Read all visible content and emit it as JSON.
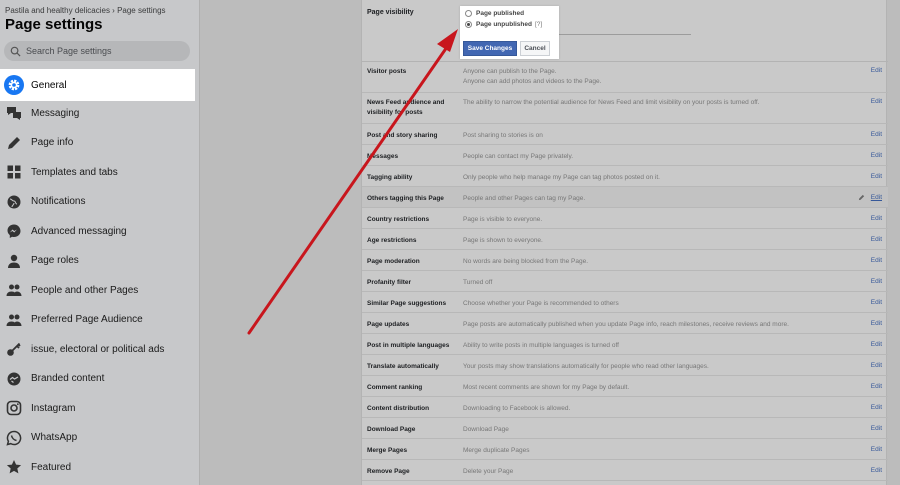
{
  "sidebar": {
    "breadcrumb": "Pastila and healthy delicacies › Page settings",
    "title": "Page settings",
    "search_placeholder": "Search Page settings",
    "items": [
      {
        "label": "General",
        "icon": "gear-icon"
      },
      {
        "label": "Messaging",
        "icon": "chat-bubbles-icon"
      },
      {
        "label": "Page info",
        "icon": "pencil-icon"
      },
      {
        "label": "Templates and tabs",
        "icon": "grid-icon"
      },
      {
        "label": "Notifications",
        "icon": "globe-icon"
      },
      {
        "label": "Advanced messaging",
        "icon": "messenger-icon"
      },
      {
        "label": "Page roles",
        "icon": "person-icon"
      },
      {
        "label": "People and other Pages",
        "icon": "people-icon"
      },
      {
        "label": "Preferred Page Audience",
        "icon": "audience-icon"
      },
      {
        "label": "issue, electoral or political ads",
        "icon": "key-icon"
      },
      {
        "label": "Branded content",
        "icon": "handshake-icon"
      },
      {
        "label": "Instagram",
        "icon": "instagram-icon"
      },
      {
        "label": "WhatsApp",
        "icon": "whatsapp-icon"
      },
      {
        "label": "Featured",
        "icon": "star-icon"
      }
    ]
  },
  "visibility": {
    "label": "Page visibility",
    "options": [
      {
        "label": "Page published",
        "selected": false
      },
      {
        "label": "Page unpublished",
        "selected": true,
        "hint": "[?]"
      }
    ],
    "save_label": "Save Changes",
    "cancel_label": "Cancel"
  },
  "settings": [
    {
      "name": "Visitor posts",
      "desc": "Anyone can publish to the Page.",
      "desc2": "Anyone can add photos and videos to the Page.",
      "edit": "Edit"
    },
    {
      "name": "News Feed audience and visibility for posts",
      "desc": "The ability to narrow the potential audience for News Feed and limit visibility on your posts is turned off.",
      "edit": "Edit"
    },
    {
      "name": "Post and story sharing",
      "desc": "Post sharing to stories is on",
      "edit": "Edit"
    },
    {
      "name": "Messages",
      "desc": "People can contact my Page privately.",
      "edit": "Edit"
    },
    {
      "name": "Tagging ability",
      "desc": "Only people who help manage my Page can tag photos posted on it.",
      "edit": "Edit"
    },
    {
      "name": "Others tagging this Page",
      "desc": "People and other Pages can tag my Page.",
      "edit": "Edit"
    },
    {
      "name": "Country restrictions",
      "desc": "Page is visible to everyone.",
      "edit": "Edit"
    },
    {
      "name": "Age restrictions",
      "desc": "Page is shown to everyone.",
      "edit": "Edit"
    },
    {
      "name": "Page moderation",
      "desc": "No words are being blocked from the Page.",
      "edit": "Edit"
    },
    {
      "name": "Profanity filter",
      "desc": "Turned off",
      "edit": "Edit"
    },
    {
      "name": "Similar Page suggestions",
      "desc": "Choose whether your Page is recommended to others",
      "edit": "Edit"
    },
    {
      "name": "Page updates",
      "desc": "Page posts are automatically published when you update Page info, reach milestones, receive reviews and more.",
      "edit": "Edit"
    },
    {
      "name": "Post in multiple languages",
      "desc": "Ability to write posts in multiple languages is turned off",
      "edit": "Edit"
    },
    {
      "name": "Translate automatically",
      "desc": "Your posts may show translations automatically for people who read other languages.",
      "edit": "Edit"
    },
    {
      "name": "Comment ranking",
      "desc": "Most recent comments are shown for my Page by default.",
      "edit": "Edit"
    },
    {
      "name": "Content distribution",
      "desc": "Downloading to Facebook is allowed.",
      "edit": "Edit"
    },
    {
      "name": "Download Page",
      "desc": "Download Page",
      "edit": "Edit"
    },
    {
      "name": "Merge Pages",
      "desc": "Merge duplicate Pages",
      "edit": "Edit"
    },
    {
      "name": "Remove Page",
      "desc": "Delete your Page",
      "edit": "Edit"
    }
  ],
  "colors": {
    "accent": "#1877f2",
    "arrow": "#c8161d",
    "save_button": "#4267b2"
  }
}
